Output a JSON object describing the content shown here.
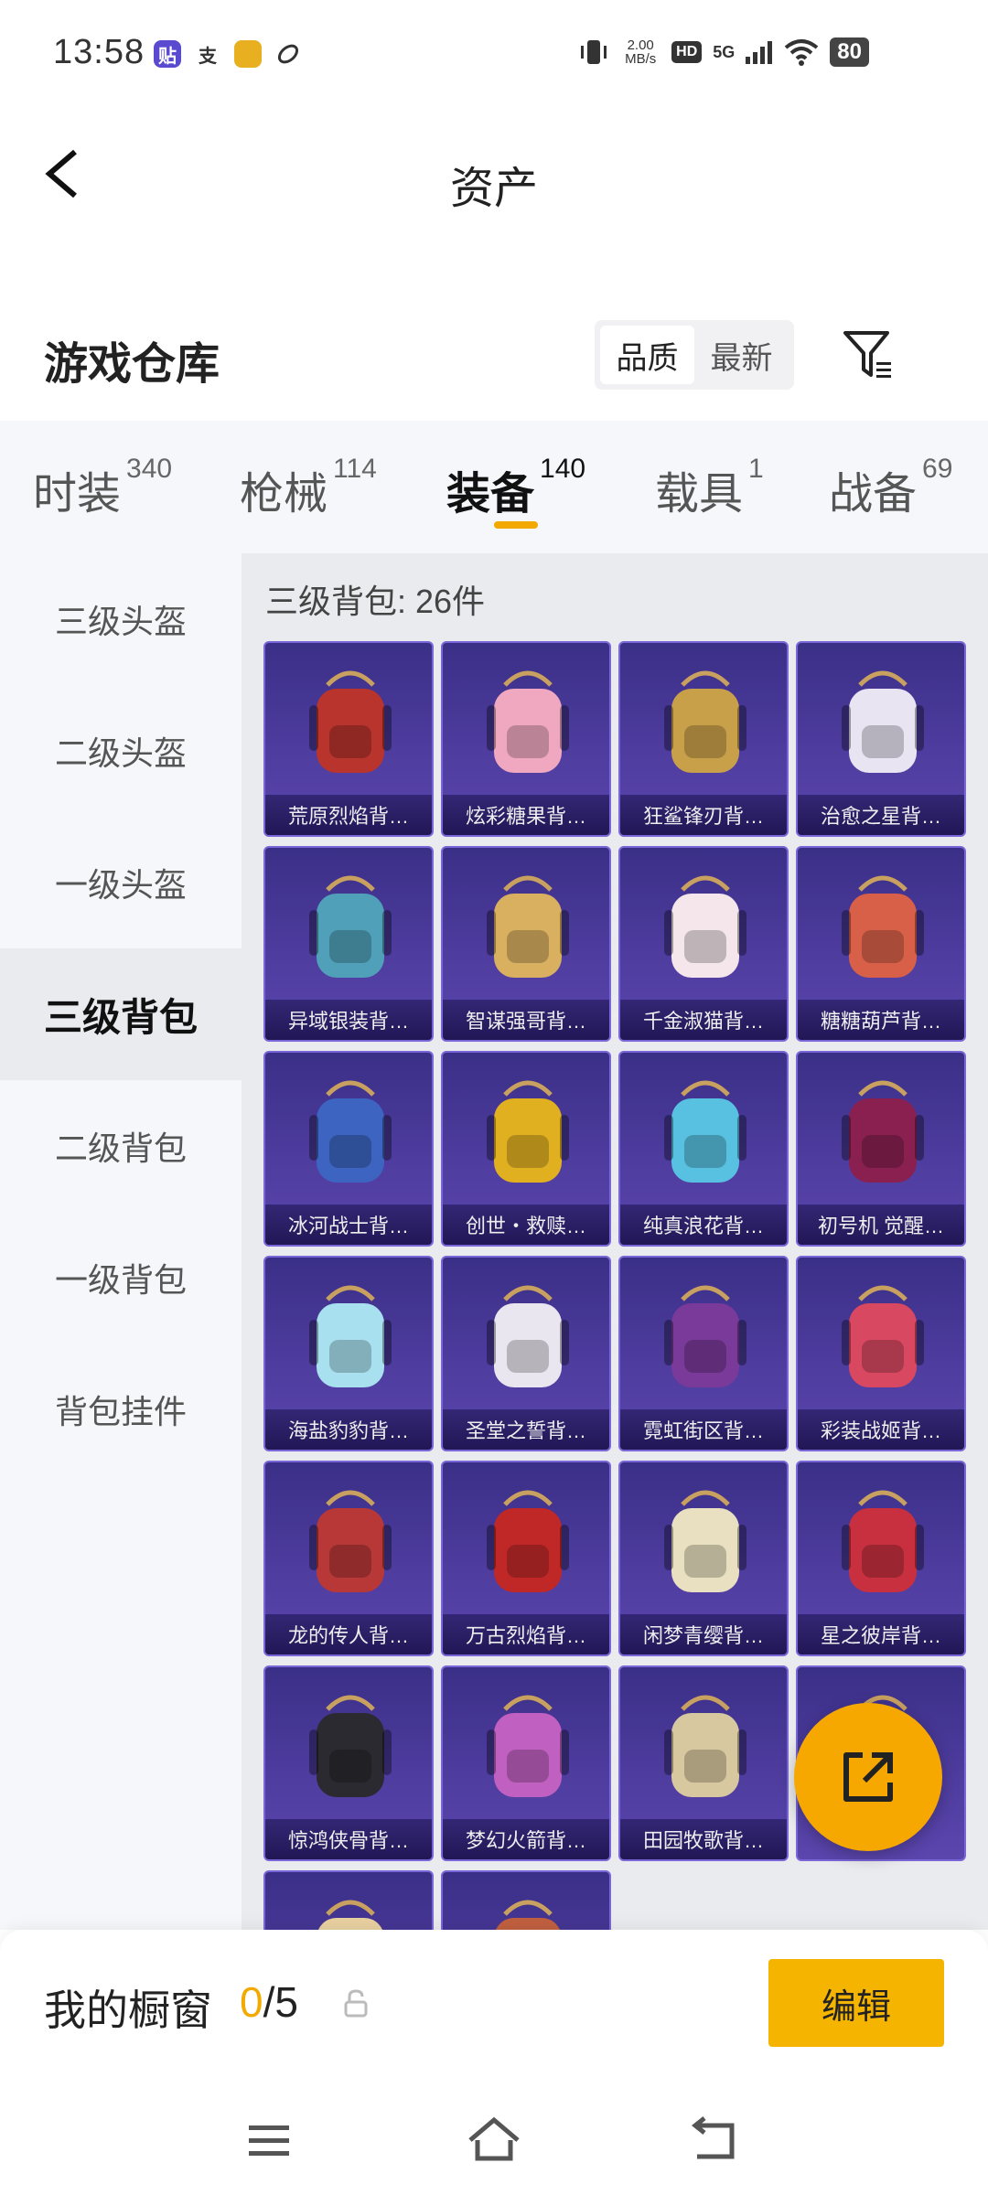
{
  "status_bar": {
    "time": "13:58",
    "speed_top": "2.00",
    "speed_unit": "MB/s",
    "hd": "HD",
    "network": "5G",
    "battery": "80"
  },
  "header": {
    "title": "资产"
  },
  "section": {
    "title": "游戏仓库",
    "sort_quality": "品质",
    "sort_newest": "最新"
  },
  "tabs": [
    {
      "label": "时装",
      "count": "340"
    },
    {
      "label": "枪械",
      "count": "114"
    },
    {
      "label": "装备",
      "count": "140"
    },
    {
      "label": "载具",
      "count": "1"
    },
    {
      "label": "战备",
      "count": "69"
    }
  ],
  "sidebar": {
    "items": [
      {
        "label": "三级头盔"
      },
      {
        "label": "二级头盔"
      },
      {
        "label": "一级头盔"
      },
      {
        "label": "三级背包"
      },
      {
        "label": "二级背包"
      },
      {
        "label": "一级背包"
      },
      {
        "label": "背包挂件"
      }
    ],
    "active_index": 3
  },
  "content": {
    "heading": "三级背包: 26件",
    "items": [
      {
        "label": "荒原烈焰背…",
        "color": "#b8342c"
      },
      {
        "label": "炫彩糖果背…",
        "color": "#f0a8c0"
      },
      {
        "label": "狂鲨锋刃背…",
        "color": "#c9a04a"
      },
      {
        "label": "治愈之星背…",
        "color": "#e8e4f2"
      },
      {
        "label": "异域银装背…",
        "color": "#4fa0b8"
      },
      {
        "label": "智谋强哥背…",
        "color": "#d9b060"
      },
      {
        "label": "千金淑猫背…",
        "color": "#f4e6ea"
      },
      {
        "label": "糖糖葫芦背…",
        "color": "#d86048"
      },
      {
        "label": "冰河战士背…",
        "color": "#3c64c0"
      },
      {
        "label": "创世・救赎…",
        "color": "#e0b020"
      },
      {
        "label": "纯真浪花背…",
        "color": "#58c0e0"
      },
      {
        "label": "初号机 觉醒…",
        "color": "#8a2050"
      },
      {
        "label": "海盐豹豹背…",
        "color": "#a8e0f0"
      },
      {
        "label": "圣堂之誓背…",
        "color": "#eae6f0"
      },
      {
        "label": "霓虹街区背…",
        "color": "#7a3a9a"
      },
      {
        "label": "彩装战姬背…",
        "color": "#d84860"
      },
      {
        "label": "龙的传人背…",
        "color": "#b83838"
      },
      {
        "label": "万古烈焰背…",
        "color": "#c02828"
      },
      {
        "label": "闲梦青缨背…",
        "color": "#e8e0c0"
      },
      {
        "label": "星之彼岸背…",
        "color": "#c83040"
      },
      {
        "label": "惊鸿侠骨背…",
        "color": "#2a2a30"
      },
      {
        "label": "梦幻火箭背…",
        "color": "#c060c0"
      },
      {
        "label": "田园牧歌背…",
        "color": "#d8c8a0"
      },
      {
        "label": "",
        "color": "#e08060"
      },
      {
        "label": "",
        "color": "#e8d0a0"
      },
      {
        "label": "",
        "color": "#c06040"
      }
    ]
  },
  "bottom": {
    "showcase_label": "我的橱窗",
    "current": "0",
    "total": "/5",
    "edit_label": "编辑"
  },
  "colors": {
    "accent": "#f2a900",
    "card_bg": "#4e3c9e",
    "sidebar_bg": "#f5f7fb"
  }
}
